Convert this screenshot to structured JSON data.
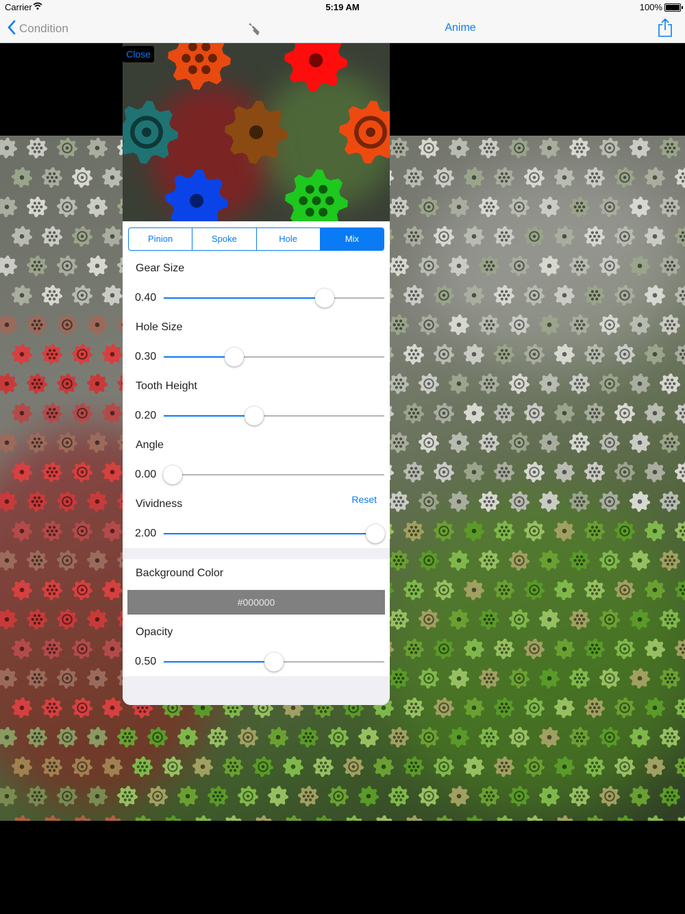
{
  "status_bar": {
    "carrier": "Carrier",
    "time": "5:19 AM",
    "battery": "100%"
  },
  "nav": {
    "back_label": "Condition",
    "title_button": "Anime"
  },
  "popover": {
    "close_label": "Close",
    "segments": [
      "Pinion",
      "Spoke",
      "Hole",
      "Mix"
    ],
    "selected_segment": "Mix",
    "sliders": [
      {
        "label": "Gear Size",
        "value": "0.40",
        "fraction": 0.73
      },
      {
        "label": "Hole Size",
        "value": "0.30",
        "fraction": 0.32
      },
      {
        "label": "Tooth Height",
        "value": "0.20",
        "fraction": 0.41
      },
      {
        "label": "Angle",
        "value": "0.00",
        "fraction": 0.04
      },
      {
        "label": "Vividness",
        "value": "2.00",
        "fraction": 0.96
      }
    ],
    "reset_label": "Reset",
    "background_color_label": "Background Color",
    "background_color_value": "#000000",
    "opacity": {
      "label": "Opacity",
      "value": "0.50",
      "fraction": 0.5
    }
  },
  "colors": {
    "accent": "#0a7bf5"
  }
}
